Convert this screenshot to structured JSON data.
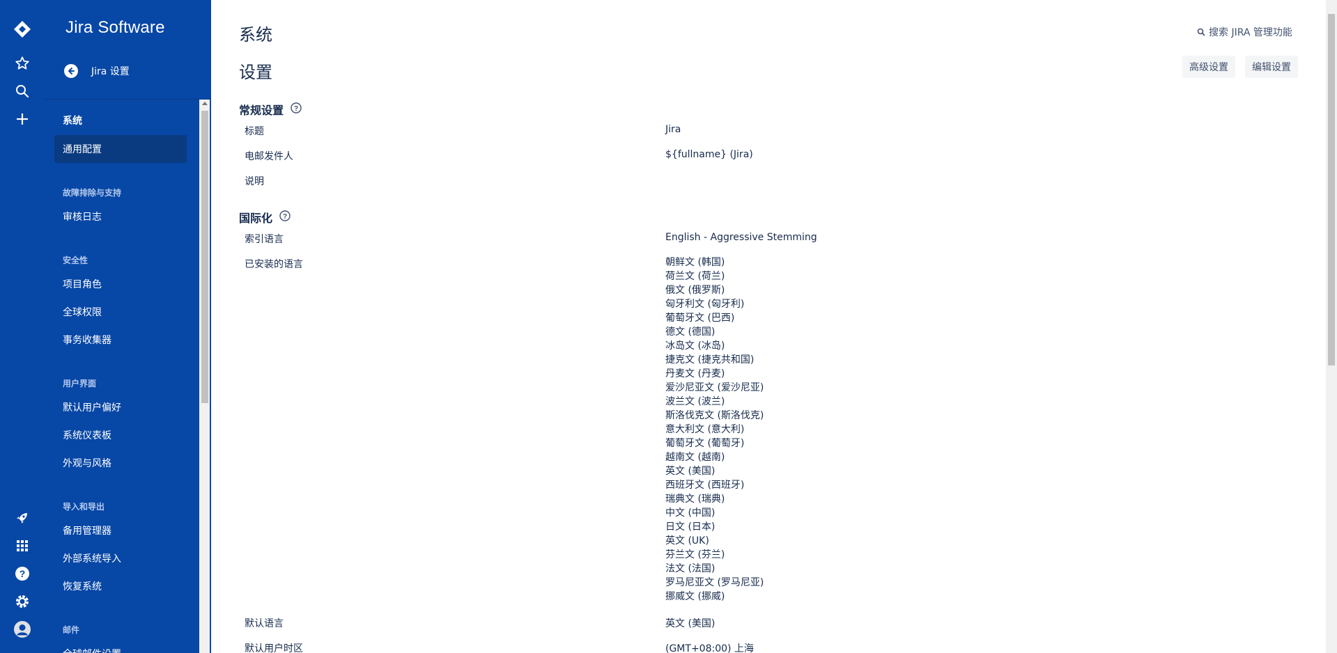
{
  "rail": {
    "icons": [
      "jira-logo-icon",
      "star-icon",
      "search-icon",
      "plus-icon",
      "rocket-icon",
      "app-switcher-icon",
      "help-icon",
      "gear-icon",
      "avatar-icon"
    ]
  },
  "sidebar": {
    "product_name": "Jira Software",
    "back_label": "Jira 设置",
    "items": {
      "system": "系统",
      "general_config": "通用配置",
      "troubleshooting_head": "故障排除与支持",
      "audit_log": "审核日志",
      "security_head": "安全性",
      "project_roles": "项目角色",
      "global_permissions": "全球权限",
      "issue_collectors": "事务收集器",
      "ui_head": "用户界面",
      "default_user_prefs": "默认用户偏好",
      "system_dashboard": "系统仪表板",
      "look_and_feel": "外观与风格",
      "import_export_head": "导入和导出",
      "backup_manager": "备用管理器",
      "external_import": "外部系统导入",
      "restore_system": "恢复系统",
      "mail_head": "邮件",
      "global_mail_settings": "全球邮件设置"
    }
  },
  "header": {
    "title": "系统",
    "search_admin": "搜索 JIRA 管理功能"
  },
  "settings": {
    "title": "设置",
    "advanced_button": "高级设置",
    "edit_button": "编辑设置"
  },
  "general": {
    "heading": "常规设置",
    "title_label": "标题",
    "title_value": "Jira",
    "email_from_label": "电邮发件人",
    "email_from_value": "${fullname} (Jira)",
    "description_label": "说明"
  },
  "i18n": {
    "heading": "国际化",
    "index_lang_label": "索引语言",
    "index_lang_value": "English - Aggressive Stemming",
    "installed_label": "已安装的语言",
    "installed_languages": [
      "朝鲜文 (韩国)",
      "荷兰文 (荷兰)",
      "俄文 (俄罗斯)",
      "匈牙利文 (匈牙利)",
      "葡萄牙文 (巴西)",
      "德文 (德国)",
      "冰岛文 (冰岛)",
      "捷克文 (捷克共和国)",
      "丹麦文 (丹麦)",
      "爱沙尼亚文 (爱沙尼亚)",
      "波兰文 (波兰)",
      "斯洛伐克文 (斯洛伐克)",
      "意大利文 (意大利)",
      "葡萄牙文 (葡萄牙)",
      "越南文 (越南)",
      "英文 (美国)",
      "西班牙文 (西班牙)",
      "瑞典文 (瑞典)",
      "中文 (中国)",
      "日文 (日本)",
      "英文 (UK)",
      "芬兰文 (芬兰)",
      "法文 (法国)",
      "罗马尼亚文 (罗马尼亚)",
      "挪威文 (挪威)"
    ],
    "default_lang_label": "默认语言",
    "default_lang_value": "英文 (美国)",
    "default_tz_label": "默认用户时区",
    "default_tz_value": "(GMT+08:00) 上海"
  }
}
